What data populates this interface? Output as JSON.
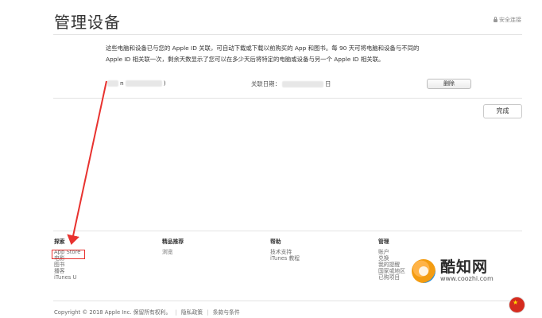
{
  "header": {
    "title": "管理设备",
    "secure_link": "安全连接"
  },
  "main": {
    "description_line1": "这些电脑和设备已与您的 Apple ID 关联，可自动下载或下载以前购买的 App 和图书。每 90 天可将电脑和设备与不同的",
    "description_line2": "Apple ID 相关联一次，剩余天数显示了您可以在多少天后将特定的电脑或设备与另一个 Apple ID 相关联。",
    "device_name_prefix": "n",
    "device_name_suffix": ")",
    "assoc_date_label": "关联日期：",
    "assoc_date_suffix": "日",
    "remove_label": "删除",
    "done_label": "完成"
  },
  "footer": {
    "columns": [
      {
        "title": "探索",
        "links": [
          "App Store",
          "电影",
          "图书",
          "播客",
          "iTunes U"
        ]
      },
      {
        "title": "精品推荐",
        "links": [
          "浏览"
        ]
      },
      {
        "title": "帮助",
        "links": [
          "技术支持",
          "iTunes 教程"
        ]
      },
      {
        "title": "管理",
        "links": [
          "账户",
          "兑换",
          "我的提醒",
          "国家或地区",
          "已购项目"
        ]
      }
    ],
    "copyright": "Copyright © 2018 Apple Inc. 保留所有权利。",
    "privacy": "隐私政策",
    "terms": "条款与条件"
  },
  "watermark": {
    "name": "酷知网",
    "url": "www.coozhi.com"
  },
  "colors": {
    "annotation_red": "#e8322f",
    "flag_red": "#d52b1e"
  }
}
